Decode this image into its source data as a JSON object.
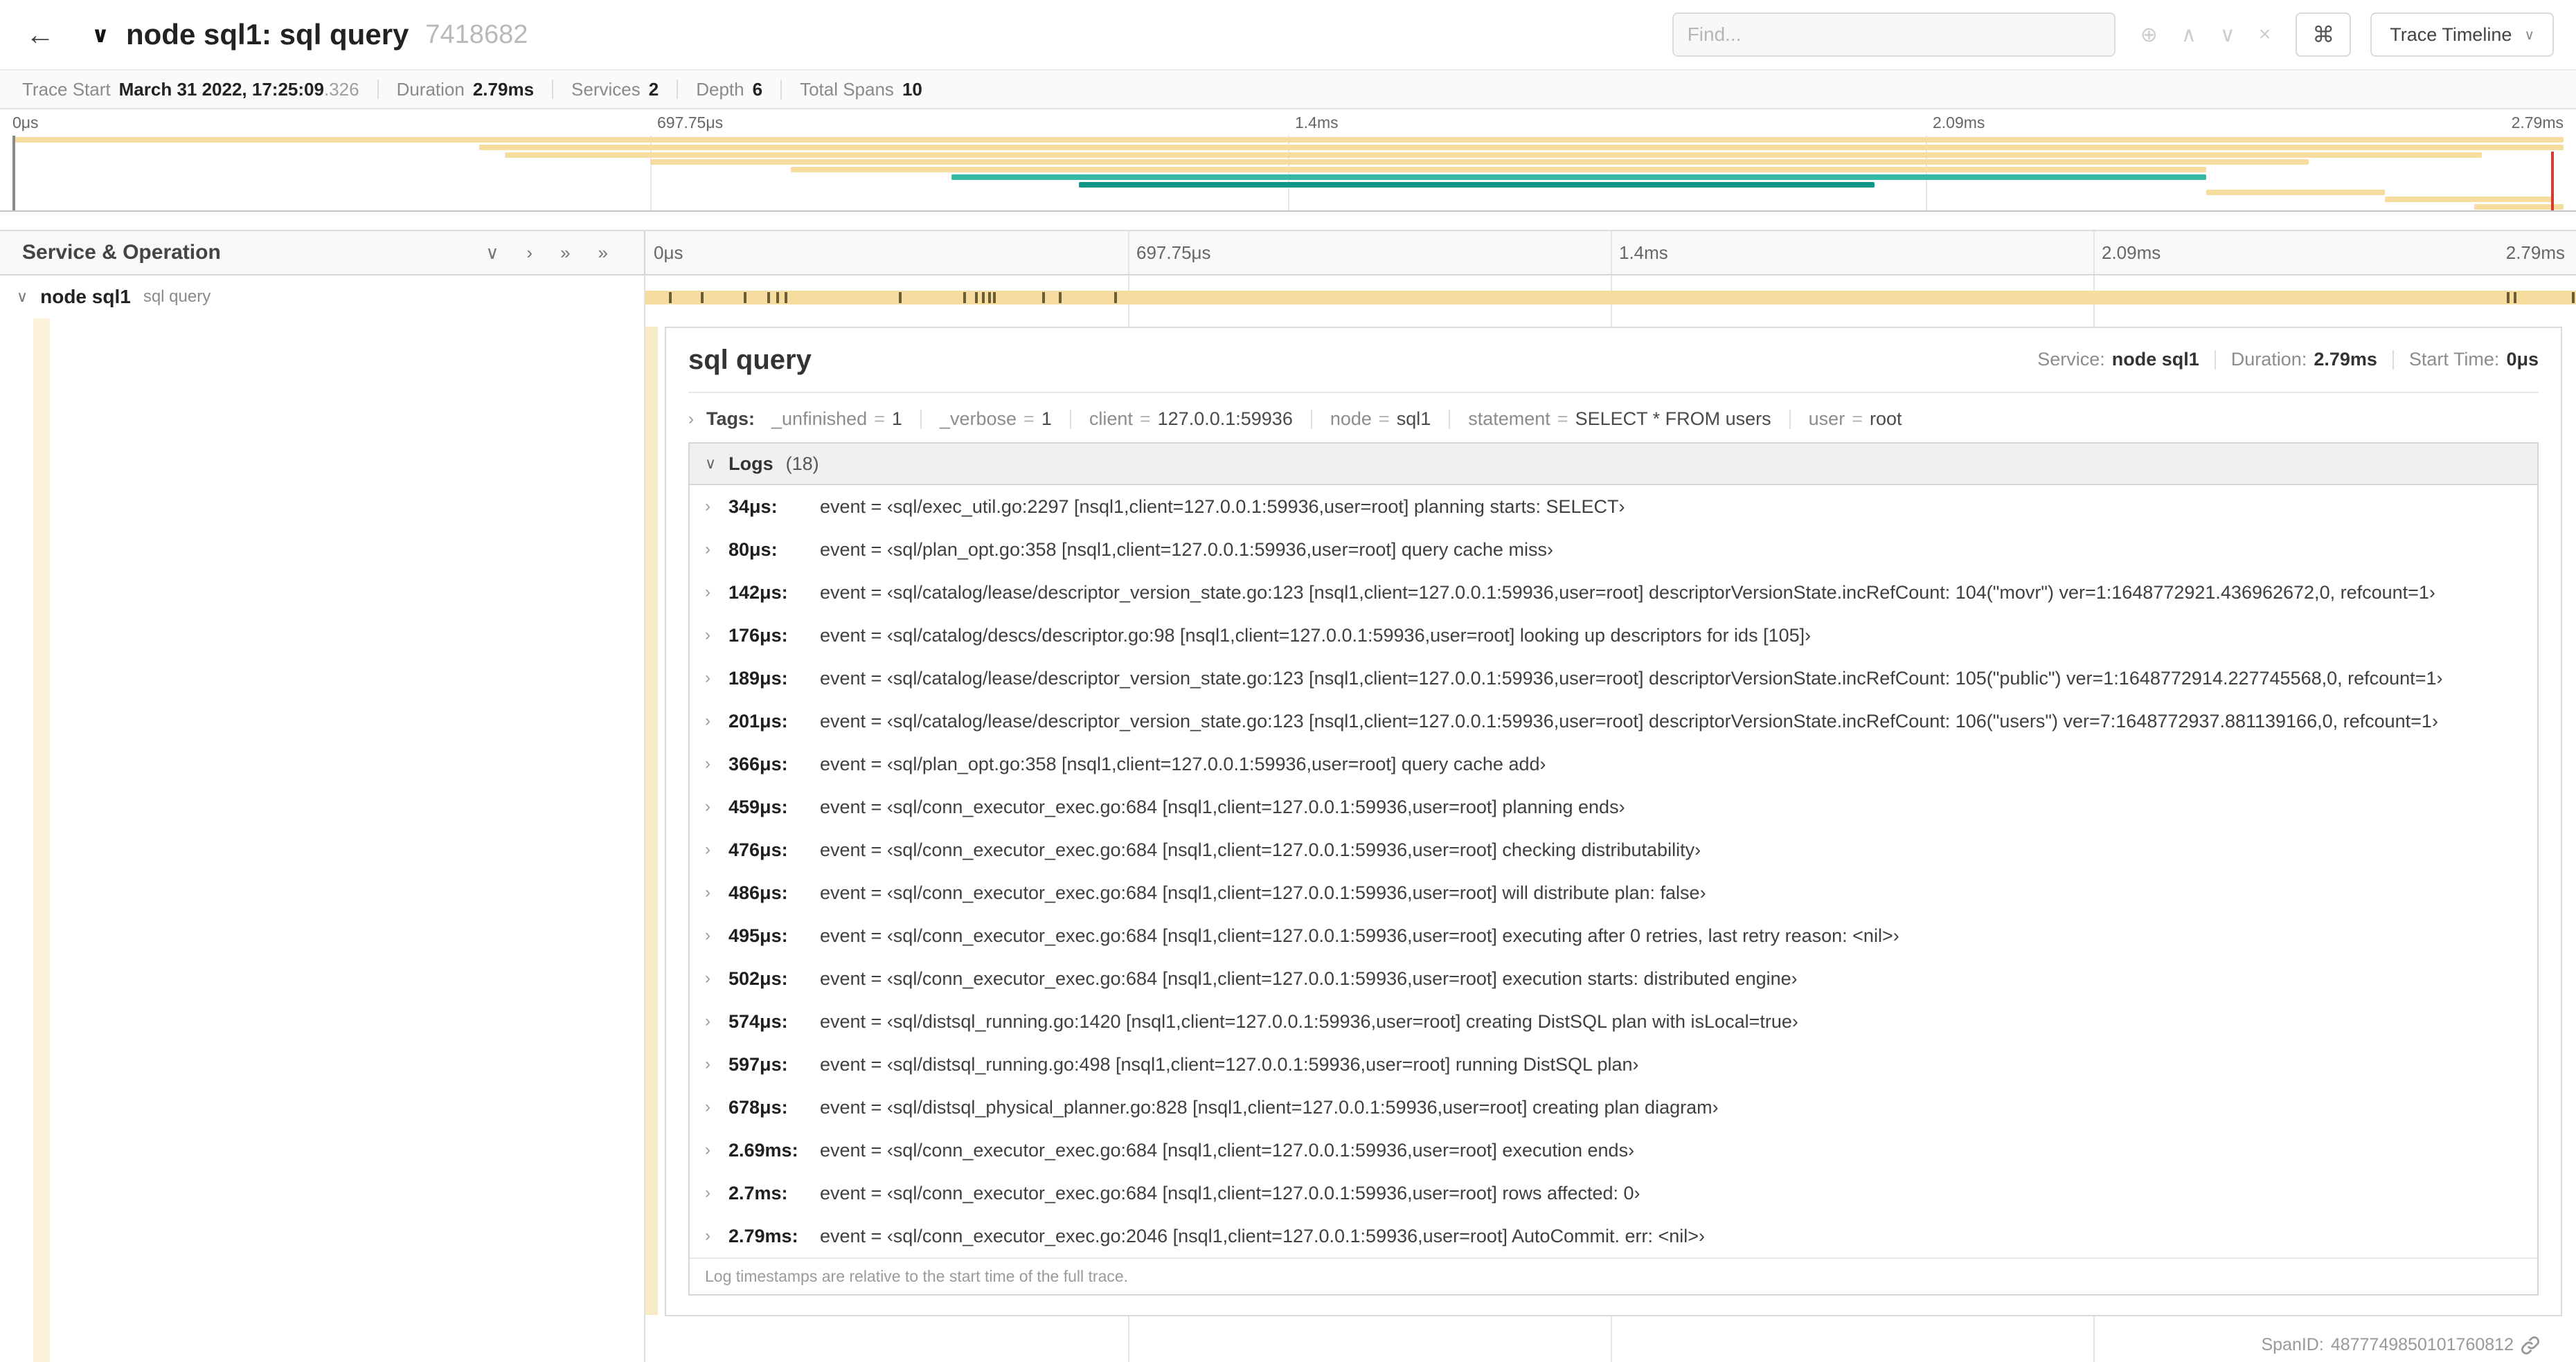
{
  "icons": {
    "back": "←",
    "chevron_down": "∨",
    "chevron_right": "›",
    "caret": "∨",
    "command": "⌘"
  },
  "colors": {
    "span_tan": "#F6DC9F",
    "teal": "#35B8A6",
    "teal_dark": "#0F9488",
    "log_tick": "#6B5D33",
    "cursor_red": "#D23B32",
    "guide": "#FBF2D9",
    "accent": "#F8ECC7"
  },
  "header": {
    "title": "node sql1: sql query",
    "trace_id": "7418682",
    "find_placeholder": "Find...",
    "view_selector_label": "Trace Timeline",
    "find_icons": [
      {
        "name": "search-focus-icon",
        "glyph": "⊕"
      },
      {
        "name": "prev-result-icon",
        "glyph": "∧"
      },
      {
        "name": "next-result-icon",
        "glyph": "∨"
      },
      {
        "name": "clear-search-icon",
        "glyph": "×"
      }
    ]
  },
  "summary": {
    "items": [
      {
        "label": "Trace Start",
        "value": "March 31 2022, 17:25:09",
        "suffix": ".326"
      },
      {
        "label": "Duration",
        "value": "2.79ms"
      },
      {
        "label": "Services",
        "value": "2"
      },
      {
        "label": "Depth",
        "value": "6"
      },
      {
        "label": "Total Spans",
        "value": "10"
      }
    ]
  },
  "minimap": {
    "tick_labels": [
      "0μs",
      "697.75μs",
      "1.4ms",
      "2.09ms",
      "2.79ms"
    ],
    "bars": [
      {
        "start": 0,
        "end": 100,
        "row": 0,
        "color": "span_tan"
      },
      {
        "start": 18.3,
        "end": 100,
        "row": 1,
        "color": "span_tan"
      },
      {
        "start": 19.3,
        "end": 96.8,
        "row": 2,
        "color": "span_tan"
      },
      {
        "start": 25.0,
        "end": 90.0,
        "row": 3,
        "color": "span_tan"
      },
      {
        "start": 30.5,
        "end": 86.0,
        "row": 4,
        "color": "span_tan"
      },
      {
        "start": 36.8,
        "end": 86.0,
        "row": 5,
        "color": "teal"
      },
      {
        "start": 41.8,
        "end": 73.0,
        "row": 6,
        "color": "teal_dark"
      },
      {
        "start": 86.0,
        "end": 93.0,
        "row": 7,
        "color": "span_tan"
      },
      {
        "start": 93.0,
        "end": 99.6,
        "row": 8,
        "color": "span_tan"
      },
      {
        "start": 96.5,
        "end": 100,
        "row": 9,
        "color": "span_tan"
      }
    ]
  },
  "timeline": {
    "left_header": "Service & Operation",
    "header_icons": [
      {
        "name": "collapse-one-icon",
        "glyph": "∨"
      },
      {
        "name": "expand-one-icon",
        "glyph": "›"
      },
      {
        "name": "collapse-all-icon",
        "glyph": "»"
      },
      {
        "name": "expand-all-icon",
        "glyph": "»"
      }
    ],
    "ruler_labels": [
      "0μs",
      "697.75μs",
      "1.4ms",
      "2.09ms",
      "2.79ms"
    ],
    "span_row": {
      "service": "node sql1",
      "operation": "sql query",
      "log_tick_pcts": [
        1.22,
        2.87,
        5.09,
        6.31,
        6.77,
        7.2,
        13.12,
        16.45,
        17.06,
        17.42,
        17.74,
        18.0,
        20.57,
        21.4,
        24.3,
        96.42,
        96.77,
        99.8
      ]
    }
  },
  "detail": {
    "title": "sql query",
    "meta": [
      {
        "label": "Service:",
        "value": "node sql1"
      },
      {
        "label": "Duration:",
        "value": "2.79ms"
      },
      {
        "label": "Start Time:",
        "value": "0μs"
      }
    ],
    "tags": {
      "label": "Tags:",
      "items": [
        {
          "key": "_unfinished",
          "value": "1"
        },
        {
          "key": "_verbose",
          "value": "1"
        },
        {
          "key": "client",
          "value": "127.0.0.1:59936"
        },
        {
          "key": "node",
          "value": "sql1"
        },
        {
          "key": "statement",
          "value": "SELECT * FROM users"
        },
        {
          "key": "user",
          "value": "root"
        }
      ]
    },
    "logs": {
      "label": "Logs",
      "count": "(18)",
      "entries": [
        {
          "time": "34μs:",
          "text": "event = ‹sql/exec_util.go:2297 [nsql1,client=127.0.0.1:59936,user=root] planning starts: SELECT›"
        },
        {
          "time": "80μs:",
          "text": "event = ‹sql/plan_opt.go:358 [nsql1,client=127.0.0.1:59936,user=root] query cache miss›"
        },
        {
          "time": "142μs:",
          "text": "event = ‹sql/catalog/lease/descriptor_version_state.go:123 [nsql1,client=127.0.0.1:59936,user=root] descriptorVersionState.incRefCount: 104(\"movr\") ver=1:1648772921.436962672,0, refcount=1›"
        },
        {
          "time": "176μs:",
          "text": "event = ‹sql/catalog/descs/descriptor.go:98 [nsql1,client=127.0.0.1:59936,user=root] looking up descriptors for ids [105]›"
        },
        {
          "time": "189μs:",
          "text": "event = ‹sql/catalog/lease/descriptor_version_state.go:123 [nsql1,client=127.0.0.1:59936,user=root] descriptorVersionState.incRefCount: 105(\"public\") ver=1:1648772914.227745568,0, refcount=1›"
        },
        {
          "time": "201μs:",
          "text": "event = ‹sql/catalog/lease/descriptor_version_state.go:123 [nsql1,client=127.0.0.1:59936,user=root] descriptorVersionState.incRefCount: 106(\"users\") ver=7:1648772937.881139166,0, refcount=1›"
        },
        {
          "time": "366μs:",
          "text": "event = ‹sql/plan_opt.go:358 [nsql1,client=127.0.0.1:59936,user=root] query cache add›"
        },
        {
          "time": "459μs:",
          "text": "event = ‹sql/conn_executor_exec.go:684 [nsql1,client=127.0.0.1:59936,user=root] planning ends›"
        },
        {
          "time": "476μs:",
          "text": "event = ‹sql/conn_executor_exec.go:684 [nsql1,client=127.0.0.1:59936,user=root] checking distributability›"
        },
        {
          "time": "486μs:",
          "text": "event = ‹sql/conn_executor_exec.go:684 [nsql1,client=127.0.0.1:59936,user=root] will distribute plan: false›"
        },
        {
          "time": "495μs:",
          "text": "event = ‹sql/conn_executor_exec.go:684 [nsql1,client=127.0.0.1:59936,user=root] executing after 0 retries, last retry reason: <nil>›"
        },
        {
          "time": "502μs:",
          "text": "event = ‹sql/conn_executor_exec.go:684 [nsql1,client=127.0.0.1:59936,user=root] execution starts: distributed engine›"
        },
        {
          "time": "574μs:",
          "text": "event = ‹sql/distsql_running.go:1420 [nsql1,client=127.0.0.1:59936,user=root] creating DistSQL plan with isLocal=true›"
        },
        {
          "time": "597μs:",
          "text": "event = ‹sql/distsql_running.go:498 [nsql1,client=127.0.0.1:59936,user=root] running DistSQL plan›"
        },
        {
          "time": "678μs:",
          "text": "event = ‹sql/distsql_physical_planner.go:828 [nsql1,client=127.0.0.1:59936,user=root] creating plan diagram›"
        },
        {
          "time": "2.69ms:",
          "text": "event = ‹sql/conn_executor_exec.go:684 [nsql1,client=127.0.0.1:59936,user=root] execution ends›"
        },
        {
          "time": "2.7ms:",
          "text": "event = ‹sql/conn_executor_exec.go:684 [nsql1,client=127.0.0.1:59936,user=root] rows affected: 0›"
        },
        {
          "time": "2.79ms:",
          "text": "event = ‹sql/conn_executor_exec.go:2046 [nsql1,client=127.0.0.1:59936,user=root] AutoCommit. err: <nil>›"
        }
      ],
      "footer": "Log timestamps are relative to the start time of the full trace."
    },
    "span_id": {
      "label": "SpanID:",
      "value": "4877749850101760812"
    }
  }
}
